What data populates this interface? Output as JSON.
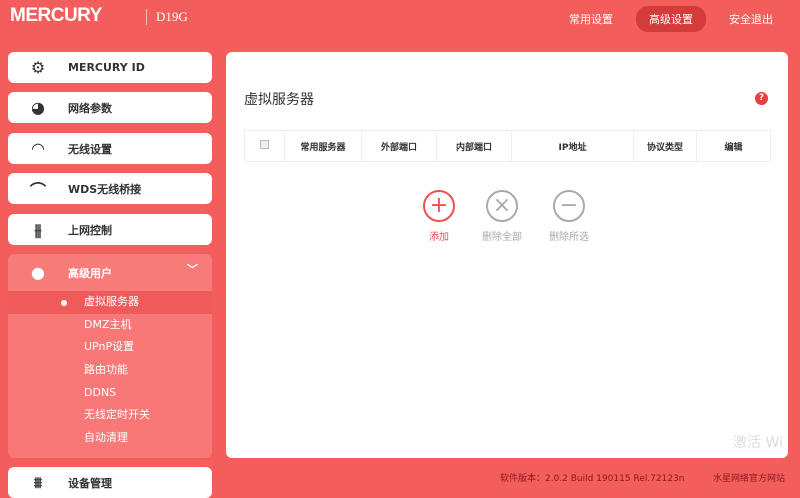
{
  "header": {
    "logo": "MERCURY",
    "model": "D19G",
    "nav": [
      "常用设置",
      "高级设置",
      "安全退出"
    ],
    "active_nav": 1
  },
  "sidebar": {
    "items": [
      {
        "label": "MERCURY ID",
        "icon": "gear-icon"
      },
      {
        "label": "网络参数",
        "icon": "globe-icon"
      },
      {
        "label": "无线设置",
        "icon": "wifi-icon"
      },
      {
        "label": "WDS无线桥接",
        "icon": "bridge-icon"
      },
      {
        "label": "上网控制",
        "icon": "sliders-icon"
      },
      {
        "label": "高级用户",
        "icon": "user-icon"
      },
      {
        "label": "设备管理",
        "icon": "router-icon"
      }
    ],
    "submenu": [
      "虚拟服务器",
      "DMZ主机",
      "UPnP设置",
      "路由功能",
      "DDNS",
      "无线定时开关",
      "自动清理"
    ],
    "active_sub": 0
  },
  "main": {
    "title": "虚拟服务器",
    "columns": [
      "常用服务器",
      "外部端口",
      "内部端口",
      "IP地址",
      "协议类型",
      "编辑"
    ],
    "actions": {
      "add": "添加",
      "delete_all": "删除全部",
      "delete_selected": "删除所选"
    }
  },
  "footer": {
    "version": "软件版本：2.0.2 Build 190115 Rel.72123n",
    "link": "水星网络官方网站"
  },
  "watermark": "激活 Wi",
  "colors": {
    "brand": "#f35d5c",
    "active": "#d43c3c"
  }
}
